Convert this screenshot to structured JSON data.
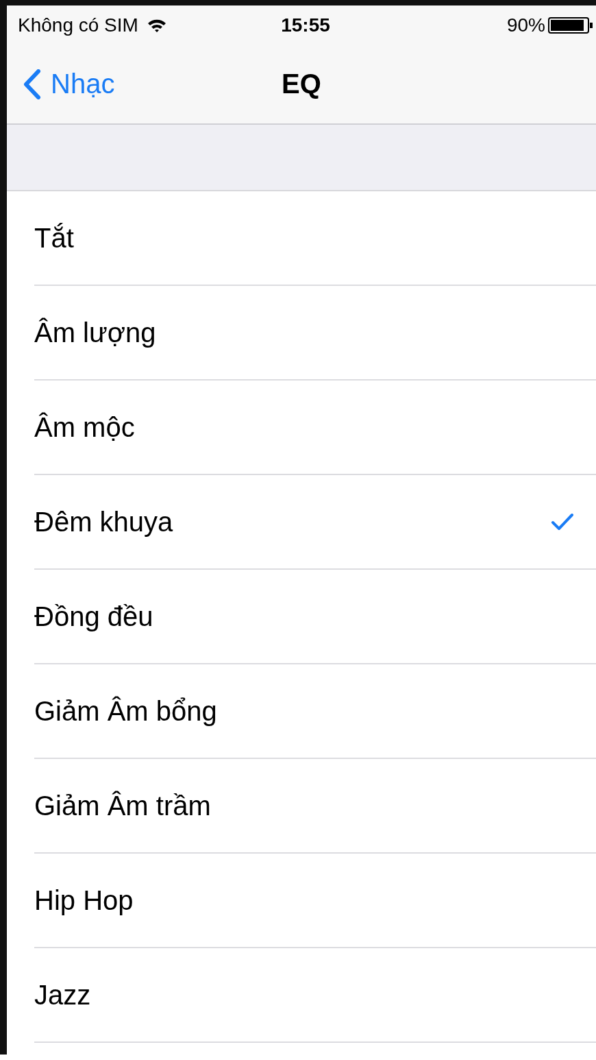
{
  "status_bar": {
    "carrier": "Không có SIM",
    "time": "15:55",
    "battery": "90%"
  },
  "nav_bar": {
    "back": "Nhạc",
    "title": "EQ"
  },
  "presets": [
    {
      "label": "Tắt",
      "selected": false
    },
    {
      "label": "Âm lượng",
      "selected": false
    },
    {
      "label": "Âm mộc",
      "selected": false
    },
    {
      "label": "Đêm khuya",
      "selected": true
    },
    {
      "label": "Đồng đều",
      "selected": false
    },
    {
      "label": "Giảm Âm bổng",
      "selected": false
    },
    {
      "label": "Giảm Âm trầm",
      "selected": false
    },
    {
      "label": "Hip Hop",
      "selected": false
    },
    {
      "label": "Jazz",
      "selected": false
    }
  ]
}
